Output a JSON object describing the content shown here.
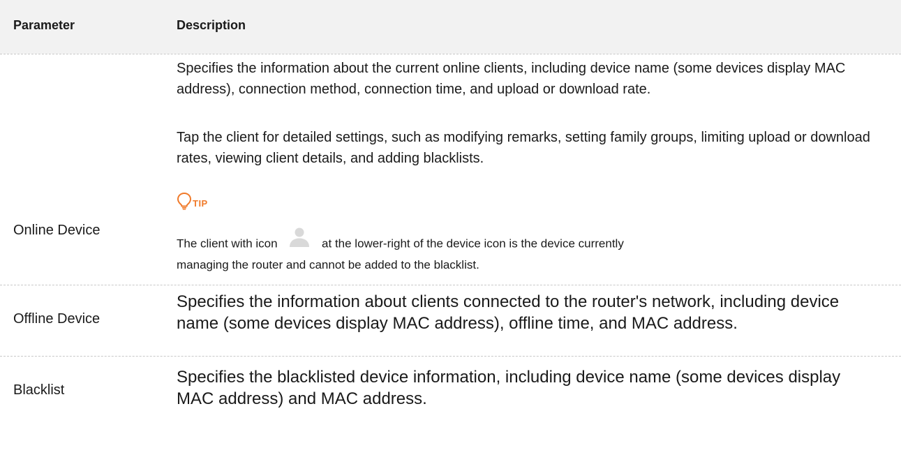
{
  "table": {
    "headers": [
      "Parameter",
      "Description"
    ],
    "rows": {
      "online": {
        "parameter": "Online Device",
        "desc1": "Specifies the information about the current online clients, including device name (some devices display MAC address), connection method, connection time, and upload or download rate.",
        "desc2": "Tap the client for detailed settings, such as modifying remarks, setting family groups, limiting upload or download rates, viewing client details, and adding blacklists.",
        "tip_label": "TIP",
        "tip_text_before": "The client with icon",
        "tip_text_after": "at the lower-right of the device icon is the device currently",
        "tip_text_line2": "managing the router and cannot be added to the blacklist."
      },
      "offline": {
        "parameter": "Offline Device",
        "desc": "Specifies the information about clients connected to the router's network, including device name (some devices display MAC address), offline time, and MAC address."
      },
      "blacklist": {
        "parameter": "Blacklist",
        "desc": "Specifies the blacklisted device information, including device name (some devices display MAC address) and MAC address."
      }
    }
  },
  "colors": {
    "header_bg": "#f2f2f2",
    "tip_accent": "#f07a2a",
    "user_icon": "#d9d9d9"
  },
  "icons": [
    "lightbulb-icon",
    "user-icon"
  ]
}
